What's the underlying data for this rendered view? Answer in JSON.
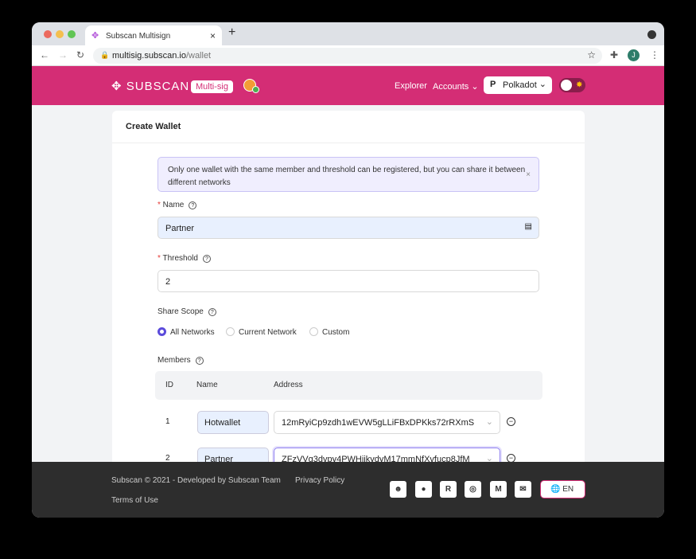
{
  "browser": {
    "tab_title": "Subscan Multisign",
    "url_host": "multisig.subscan.io",
    "url_path": "/wallet",
    "avatar_initial": "J"
  },
  "header": {
    "logo": "SUBSCAN",
    "badge": "Multi-sig",
    "nav": [
      "Explorer",
      "Accounts"
    ],
    "network": "Polkadot",
    "brand_color": "#d42d75"
  },
  "card": {
    "title": "Create Wallet",
    "alert": "Only one wallet with the same member and threshold can be registered, but you can share it between different networks",
    "name_label": "Name",
    "name_value": "Partner",
    "threshold_label": "Threshold",
    "threshold_value": "2",
    "scope_label": "Share Scope",
    "scope_options": [
      "All Networks",
      "Current Network",
      "Custom"
    ],
    "scope_selected": "All Networks",
    "members_label": "Members",
    "columns": [
      "ID",
      "Name",
      "Address"
    ],
    "members": [
      {
        "id": "1",
        "name": "Hotwallet",
        "address": "12mRyiCp9zdh1wEVW5gLLiFBxDPKks72rRXmS"
      },
      {
        "id": "2",
        "name": "Partner",
        "address": "ZFzVVg3dvpy4PWHjikydyM17mmNfXvfucp8JfM"
      }
    ]
  },
  "footer": {
    "copyright": "Subscan © 2021 - Developed by Subscan Team",
    "privacy": "Privacy Policy",
    "terms": "Terms of Use",
    "lang": "EN",
    "social": [
      "subsocial-icon",
      "twitter-icon",
      "riot-icon",
      "github-icon",
      "medium-icon",
      "email-icon"
    ]
  }
}
